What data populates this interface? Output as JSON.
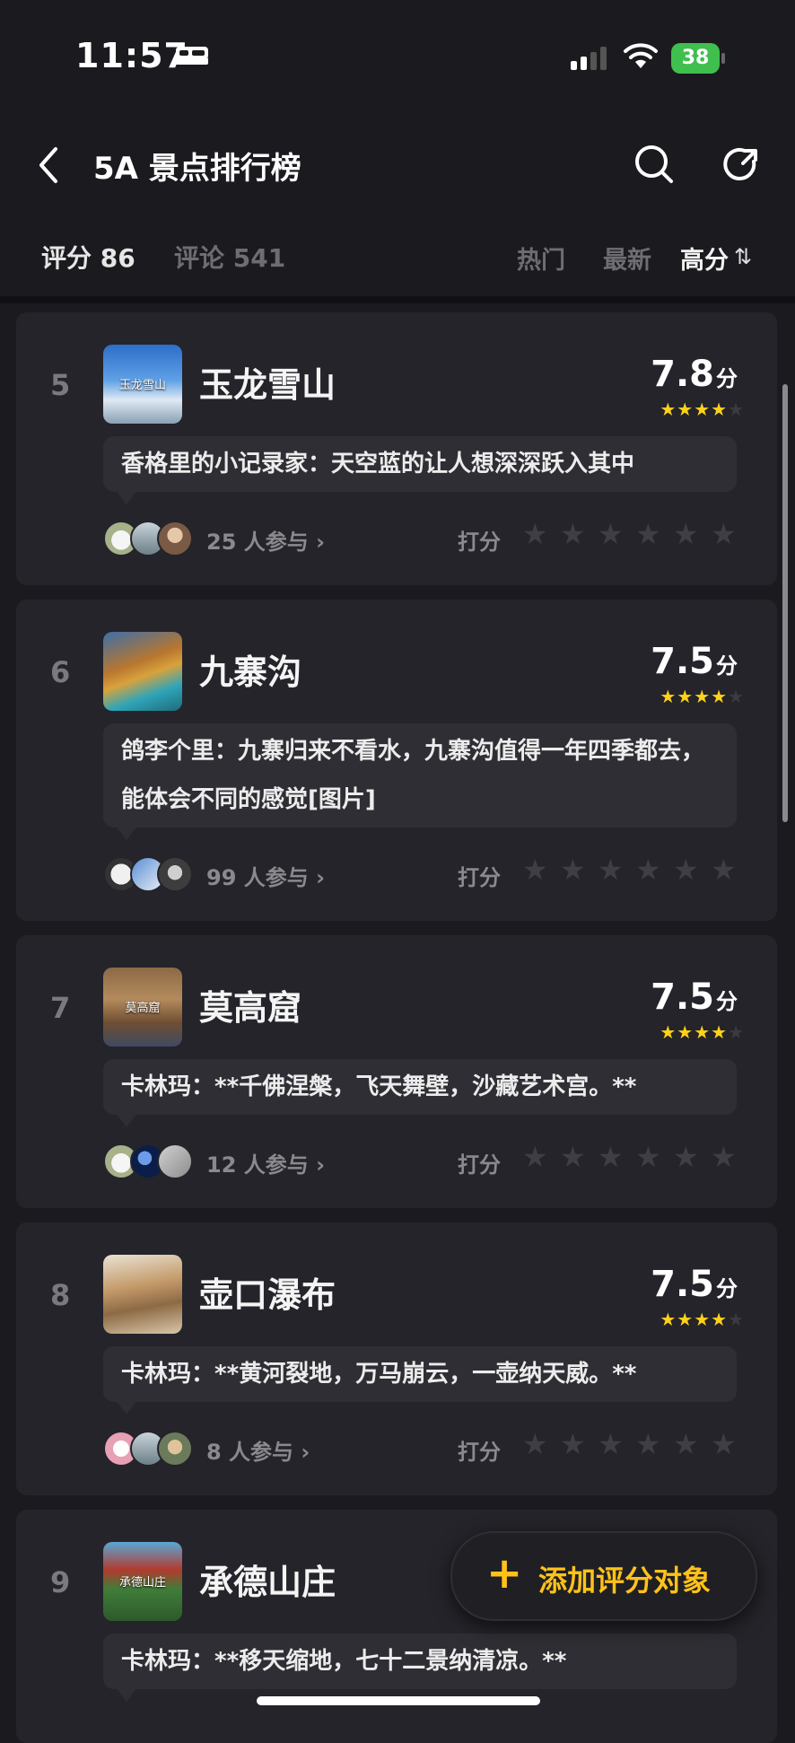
{
  "status_bar": {
    "time": "11:57",
    "battery": "38"
  },
  "header": {
    "title": "5A 景点排行榜"
  },
  "stats": {
    "rating": "评分 86",
    "comments": "评论 541"
  },
  "sort": {
    "hot": "热门",
    "new": "最新",
    "high": "高分",
    "high_icon": "⇅"
  },
  "spots": [
    {
      "rank": "5",
      "name": "玉龙雪山",
      "thumb_text": "玉龙雪山",
      "score": "7.8",
      "unit": "分",
      "stars": 4,
      "comment": "香格里的小记录家：天空蓝的让人想深深跃入其中",
      "participants": "25 人参与 ›",
      "rate_label": "打分"
    },
    {
      "rank": "6",
      "name": "九寨沟",
      "thumb_text": "",
      "score": "7.5",
      "unit": "分",
      "stars": 4,
      "comment": "鸽李个里：九寨归来不看水，九寨沟值得一年四季都去，能体会不同的感觉[图片]",
      "participants": "99 人参与 ›",
      "rate_label": "打分"
    },
    {
      "rank": "7",
      "name": "莫高窟",
      "thumb_text": "莫高窟",
      "score": "7.5",
      "unit": "分",
      "stars": 4,
      "comment": "卡林玛：**千佛涅槃，飞天舞壁，沙藏艺术宫。**",
      "participants": "12 人参与 ›",
      "rate_label": "打分"
    },
    {
      "rank": "8",
      "name": "壶口瀑布",
      "thumb_text": "",
      "score": "7.5",
      "unit": "分",
      "stars": 4,
      "comment": "卡林玛：**黄河裂地，万马崩云，一壶纳天威。**",
      "participants": "8 人参与 ›",
      "rate_label": "打分"
    },
    {
      "rank": "9",
      "name": "承德山庄",
      "thumb_text": "承德山庄",
      "score": "",
      "unit": "",
      "stars": 0,
      "comment": "卡林玛：**移天缩地，七十二景纳清凉。**",
      "participants": "",
      "rate_label": ""
    }
  ],
  "fab": {
    "plus": "+",
    "label": "添加评分对象"
  },
  "colors": {
    "accent": "#ffc21a",
    "star": "#ffd21a",
    "card": "#24242a",
    "background": "#1b1b1f"
  }
}
